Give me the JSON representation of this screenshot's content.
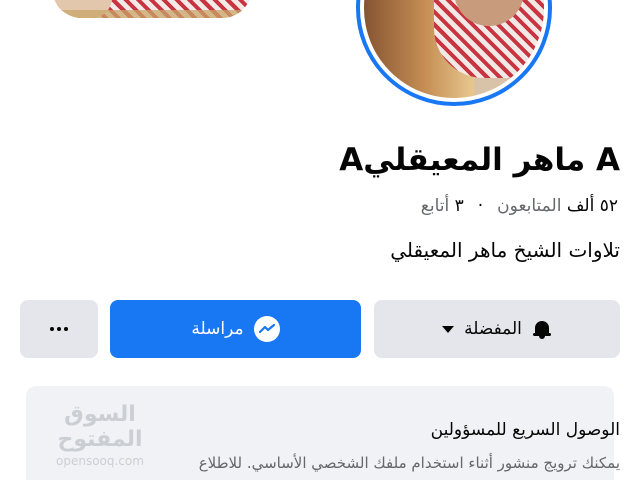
{
  "profile": {
    "name": "A ماهر المعيقليA",
    "followers_count": "٥٢ ألف",
    "followers_label": "المتابعون",
    "following_count": "٣",
    "following_label": "أتابع",
    "separator": "·",
    "bio": "تلاوات الشيخ ماهر المعيقلي"
  },
  "actions": {
    "favorites_label": "المفضلة",
    "message_label": "مراسلة",
    "more_label": "···"
  },
  "card": {
    "title": "الوصول السريع للمسؤولين",
    "text": "يمكنك ترويج منشور أثناء استخدام ملفك الشخصي الأساسي. للاطلاع"
  },
  "watermark": {
    "arabic": "السوق المفتوح",
    "latin": "opensooq.com"
  },
  "colors": {
    "brand_blue": "#1877f2",
    "button_gray": "#e4e6eb",
    "card_bg": "#f0f2f5",
    "secondary_text": "#65676b"
  },
  "icons": {
    "favorites": "bell-icon",
    "dropdown": "caret-down-icon",
    "message": "messenger-icon",
    "more": "more-dots-icon"
  }
}
